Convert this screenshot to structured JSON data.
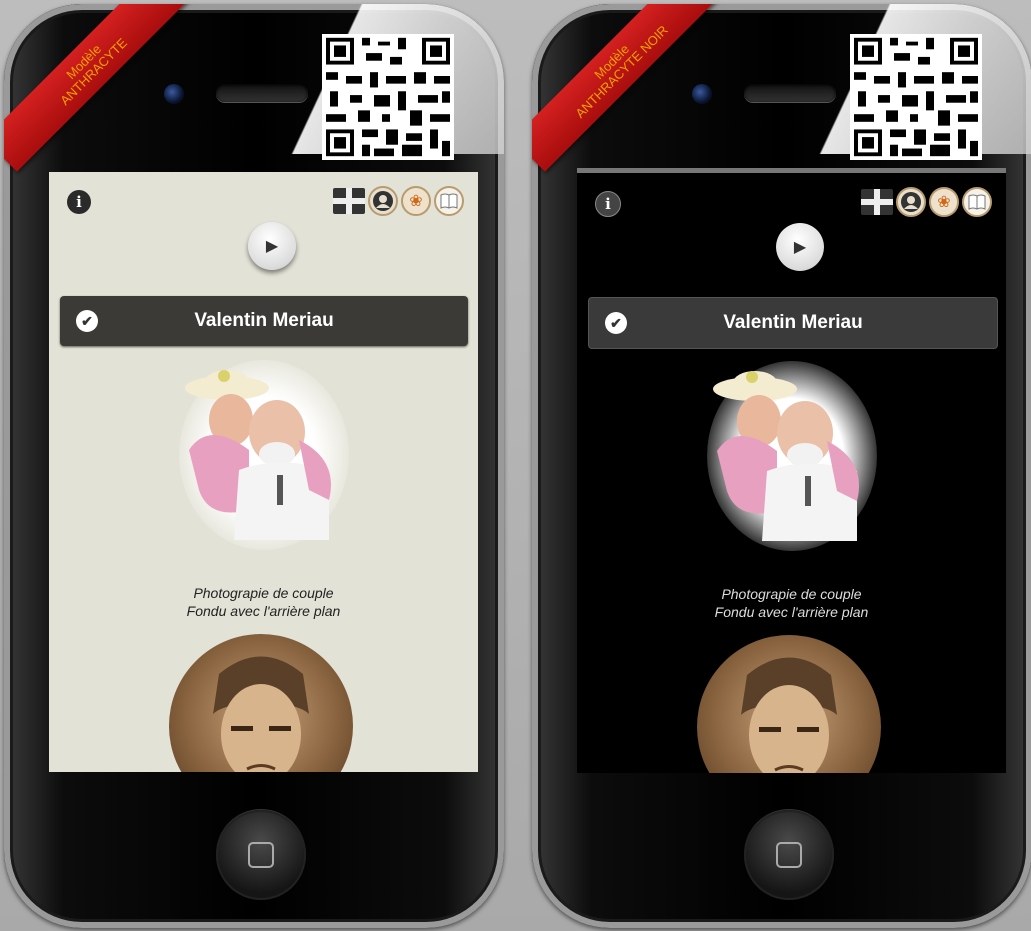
{
  "phones": [
    {
      "ribbon": {
        "line1": "Modèle",
        "line2": "ANTHRACYTE"
      },
      "profile": {
        "name": "Valentin Meriau"
      },
      "caption": {
        "line1": "Photograpie de couple",
        "line2": "Fondu avec l'arrière plan"
      }
    },
    {
      "ribbon": {
        "line1": "Modèle",
        "line2": "ANTHRACYTE NOIR"
      },
      "profile": {
        "name": "Valentin Meriau"
      },
      "caption": {
        "line1": "Photograpie de couple",
        "line2": "Fondu avec l'arrière plan"
      }
    }
  ],
  "icons": [
    "info-icon",
    "uk-flag-icon",
    "user-icon",
    "lotus-icon",
    "book-icon",
    "play-icon",
    "check-icon",
    "home-button-icon"
  ],
  "colors": {
    "ribbon": "#c41818",
    "ribbon_text": "#f0a000",
    "screen_light": "#e3e2d6",
    "screen_dark": "#000000",
    "namebar": "#3c3a36"
  }
}
